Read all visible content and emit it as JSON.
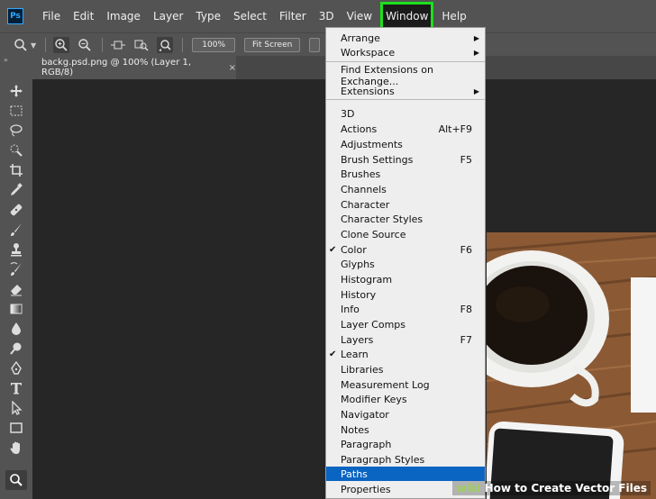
{
  "app": {
    "logo": "Ps"
  },
  "menubar": {
    "items": [
      "File",
      "Edit",
      "Image",
      "Layer",
      "Type",
      "Select",
      "Filter",
      "3D",
      "View",
      "Window",
      "Help"
    ]
  },
  "optionsbar": {
    "zoom_value": "100%",
    "fit_screen": "Fit Screen"
  },
  "document": {
    "tab_title": "backg.psd.png @ 100% (Layer 1, RGB/8)",
    "close": "×"
  },
  "window_menu": {
    "items": [
      {
        "label": "Arrange",
        "submenu": true
      },
      {
        "label": "Workspace",
        "submenu": true
      },
      {
        "label": "Find Extensions on Exchange..."
      },
      {
        "label": "Extensions",
        "submenu": true
      },
      {
        "label": "3D"
      },
      {
        "label": "Actions",
        "shortcut": "Alt+F9"
      },
      {
        "label": "Adjustments"
      },
      {
        "label": "Brush Settings",
        "shortcut": "F5"
      },
      {
        "label": "Brushes"
      },
      {
        "label": "Channels"
      },
      {
        "label": "Character"
      },
      {
        "label": "Character Styles"
      },
      {
        "label": "Clone Source"
      },
      {
        "label": "Color",
        "shortcut": "F6",
        "checked": true
      },
      {
        "label": "Glyphs"
      },
      {
        "label": "Histogram"
      },
      {
        "label": "History"
      },
      {
        "label": "Info",
        "shortcut": "F8"
      },
      {
        "label": "Layer Comps"
      },
      {
        "label": "Layers",
        "shortcut": "F7"
      },
      {
        "label": "Learn",
        "checked": true
      },
      {
        "label": "Libraries"
      },
      {
        "label": "Measurement Log"
      },
      {
        "label": "Modifier Keys"
      },
      {
        "label": "Navigator"
      },
      {
        "label": "Notes"
      },
      {
        "label": "Paragraph"
      },
      {
        "label": "Paragraph Styles"
      },
      {
        "label": "Paths",
        "highlighted": true
      },
      {
        "label": "Properties"
      }
    ]
  },
  "watermark": {
    "brand": "wiki",
    "text": "How to Create Vector Files"
  },
  "colors": {
    "menu_highlight": "#0a64c2",
    "window_outline": "#1de01d",
    "panel_bg": "#535353",
    "canvas_bg": "#262626"
  }
}
